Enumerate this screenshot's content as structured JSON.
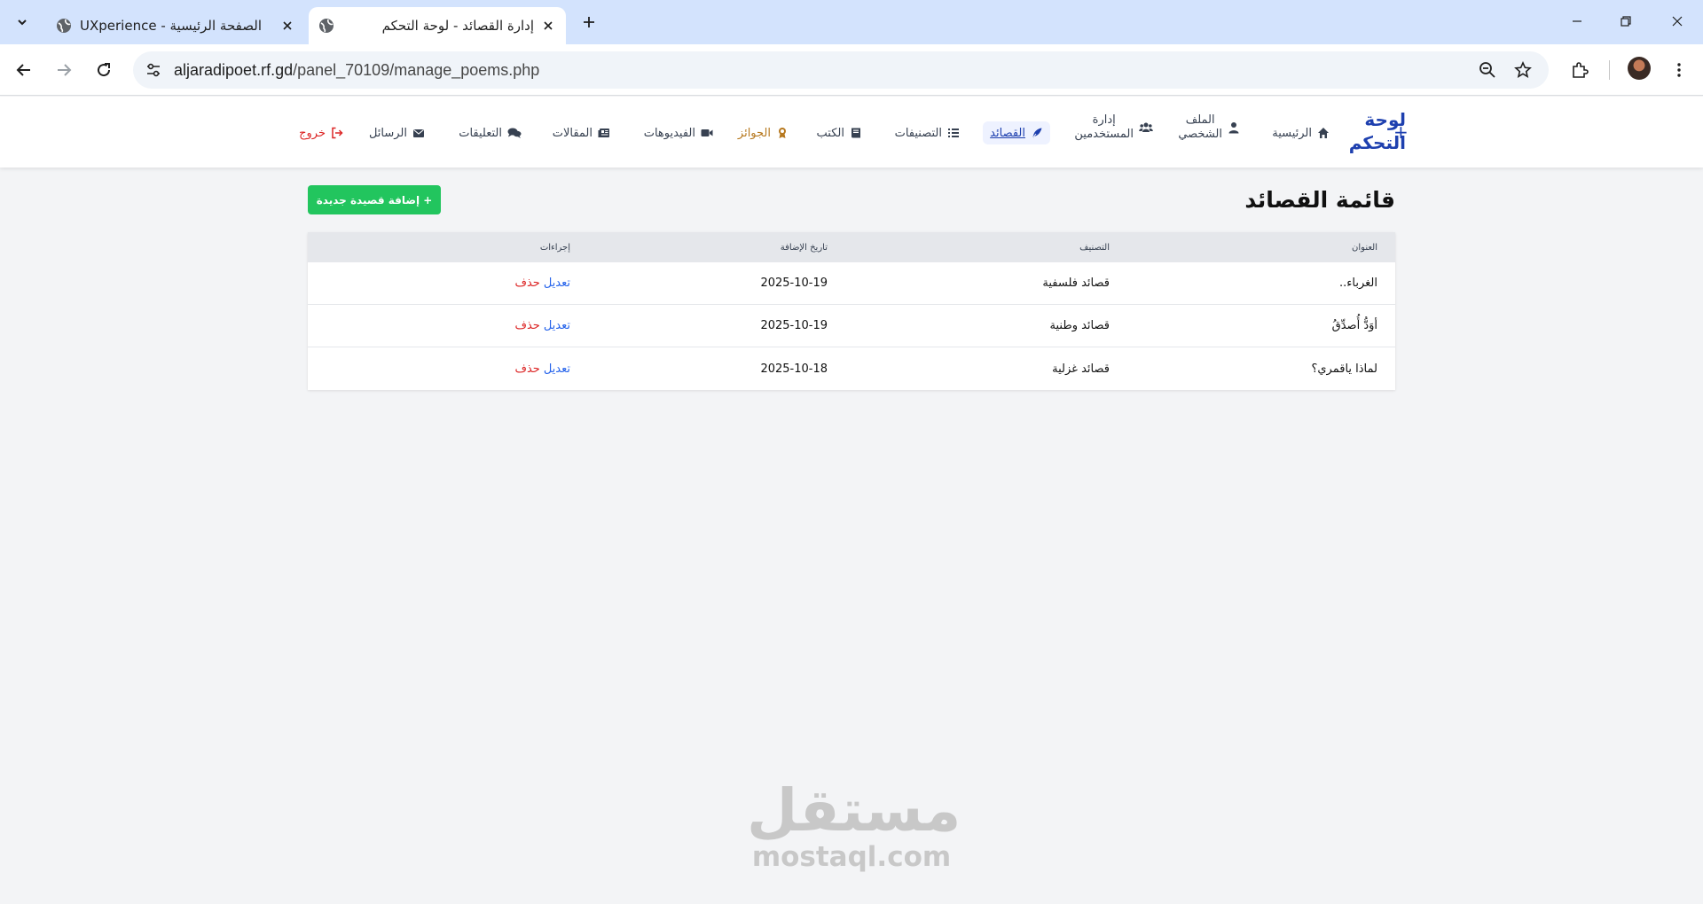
{
  "browser": {
    "tabs": [
      {
        "title": "UXperience - الصفحة الرئيسية",
        "active": false
      },
      {
        "title": "إدارة القصائد - لوحة التحكم",
        "active": true
      }
    ],
    "url_host": "aljaradipoet.rf.gd",
    "url_path": "/panel_70109/manage_poems.php"
  },
  "navbar": {
    "brand_line1": "لوحة",
    "brand_line2": "التحكم",
    "brand_plus": "+",
    "items": {
      "home": "الرئيسية",
      "profile_1": "الملف",
      "profile_2": "الشخصي",
      "users_1": "إدارة",
      "users_2": "المستخدمين",
      "poems": "القصائد",
      "categories": "التصنيفات",
      "books": "الكتب",
      "awards": "الجوائز",
      "videos": "الفيديوهات",
      "articles": "المقالات",
      "comments": "التعليقات",
      "messages": "الرسائل",
      "logout": "خروج"
    }
  },
  "page": {
    "title": "قائمة القصائد",
    "add_button": "+ إضافة قصيدة جديدة"
  },
  "table": {
    "headers": {
      "title": "العنوان",
      "category": "التصنيف",
      "date": "تاريخ الإضافة",
      "actions": "إجراءات"
    },
    "rows": [
      {
        "title": "الغرباء..",
        "category": "قصائد فلسفية",
        "date": "2025-10-19",
        "edit": "تعديل",
        "delete": "حذف"
      },
      {
        "title": "أوَدُّ أُصدِّقُ",
        "category": "قصائد وطنية",
        "date": "2025-10-19",
        "edit": "تعديل",
        "delete": "حذف"
      },
      {
        "title": "لماذا ياقمري؟",
        "category": "قصائد غزلية",
        "date": "2025-10-18",
        "edit": "تعديل",
        "delete": "حذف"
      }
    ]
  },
  "watermark": {
    "arabic": "مستقل",
    "latin": "mostaql.com"
  },
  "colors": {
    "brand": "#1e40af",
    "add_button": "#22c55e",
    "edit_link": "#2563eb",
    "delete_link": "#dc2626",
    "awards": "#b7791f"
  }
}
